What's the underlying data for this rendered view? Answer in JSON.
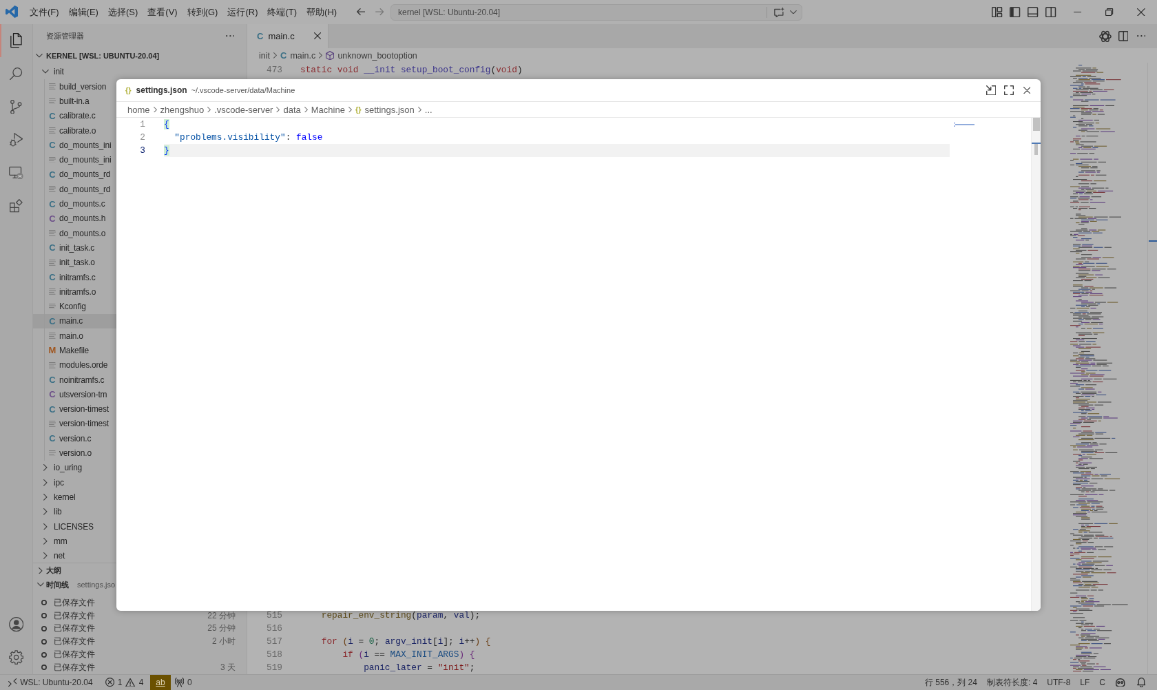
{
  "title_bar": {
    "menus": [
      "文件(F)",
      "编辑(E)",
      "选择(S)",
      "查看(V)",
      "转到(G)",
      "运行(R)",
      "终端(T)",
      "帮助(H)"
    ],
    "command_center": "kernel [WSL: Ubuntu-20.04]"
  },
  "activity_bar": {
    "top": [
      {
        "kind": "explorer",
        "selected": true
      },
      {
        "kind": "search",
        "selected": false
      },
      {
        "kind": "source-control",
        "selected": false
      },
      {
        "kind": "run-debug",
        "selected": false
      },
      {
        "kind": "remote",
        "selected": false
      },
      {
        "kind": "extensions",
        "selected": false
      }
    ],
    "bottom": [
      {
        "kind": "account"
      },
      {
        "kind": "settings"
      }
    ]
  },
  "sidebar": {
    "title": "资源管理器",
    "root": {
      "label": "KERNEL [WSL: UBUNTU-20.04]",
      "expanded": true
    },
    "tree": [
      {
        "label": "init",
        "kind": "folder",
        "expanded": true,
        "children": [
          {
            "label": "build_version",
            "kind": "text",
            "selected": false
          },
          {
            "label": "built-in.a",
            "kind": "text",
            "selected": false
          },
          {
            "label": "calibrate.c",
            "kind": "c",
            "glyph": "C",
            "selected": false
          },
          {
            "label": "calibrate.o",
            "kind": "text",
            "selected": false
          },
          {
            "label": "do_mounts_ini",
            "kind": "c",
            "glyph": "C",
            "selected": false
          },
          {
            "label": "do_mounts_ini",
            "kind": "text",
            "selected": false
          },
          {
            "label": "do_mounts_rd",
            "kind": "c",
            "glyph": "C",
            "selected": false
          },
          {
            "label": "do_mounts_rd",
            "kind": "text",
            "selected": false
          },
          {
            "label": "do_mounts.c",
            "kind": "c",
            "glyph": "C",
            "selected": false
          },
          {
            "label": "do_mounts.h",
            "kind": "h",
            "glyph": "C",
            "selected": false
          },
          {
            "label": "do_mounts.o",
            "kind": "text",
            "selected": false
          },
          {
            "label": "init_task.c",
            "kind": "c",
            "glyph": "C",
            "selected": false
          },
          {
            "label": "init_task.o",
            "kind": "text",
            "selected": false
          },
          {
            "label": "initramfs.c",
            "kind": "c",
            "glyph": "C",
            "selected": false
          },
          {
            "label": "initramfs.o",
            "kind": "text",
            "selected": false
          },
          {
            "label": "Kconfig",
            "kind": "text",
            "selected": false
          },
          {
            "label": "main.c",
            "kind": "c",
            "glyph": "C",
            "selected": true
          },
          {
            "label": "main.o",
            "kind": "text",
            "selected": false
          },
          {
            "label": "Makefile",
            "kind": "make",
            "glyph": "M",
            "selected": false
          },
          {
            "label": "modules.orde",
            "kind": "text",
            "selected": false
          },
          {
            "label": "noinitramfs.c",
            "kind": "c",
            "glyph": "C",
            "selected": false
          },
          {
            "label": "utsversion-tm",
            "kind": "h",
            "glyph": "C",
            "selected": false
          },
          {
            "label": "version-timest",
            "kind": "c",
            "glyph": "C",
            "selected": false
          },
          {
            "label": "version-timest",
            "kind": "text",
            "selected": false
          },
          {
            "label": "version.c",
            "kind": "c",
            "glyph": "C",
            "selected": false
          },
          {
            "label": "version.o",
            "kind": "text",
            "selected": false
          }
        ]
      },
      {
        "label": "io_uring",
        "kind": "folder",
        "expanded": false
      },
      {
        "label": "ipc",
        "kind": "folder",
        "expanded": false
      },
      {
        "label": "kernel",
        "kind": "folder",
        "expanded": false
      },
      {
        "label": "lib",
        "kind": "folder",
        "expanded": false
      },
      {
        "label": "LICENSES",
        "kind": "folder",
        "expanded": false
      },
      {
        "label": "mm",
        "kind": "folder",
        "expanded": false
      },
      {
        "label": "net",
        "kind": "folder",
        "expanded": false
      }
    ],
    "outline": {
      "title": "大纲",
      "expanded": false
    },
    "timeline": {
      "title": "时间线",
      "expanded": true,
      "file": "settings.jso",
      "items": [
        {
          "label": "已保存文件"
        },
        {
          "label": "已保存文件",
          "time": "22 分钟"
        },
        {
          "label": "已保存文件",
          "time": "25 分钟"
        },
        {
          "label": "已保存文件",
          "time": "2 小时"
        },
        {
          "label": "已保存文件"
        },
        {
          "label": "已保存文件",
          "time": "3 天"
        }
      ]
    }
  },
  "editor": {
    "tabs": [
      {
        "label": "main.c",
        "glyph": "C",
        "selected": true
      }
    ],
    "breadcrumbs": [
      {
        "kind": "folder",
        "label": "init"
      },
      {
        "kind": "file",
        "glyph": "C",
        "label": "main.c"
      },
      {
        "kind": "symbol",
        "label": "unknown_bootoption"
      }
    ],
    "code_top": [
      {
        "number": "473",
        "tokens": [
          {
            "text": "static void",
            "kind": "keyword"
          },
          {
            "text": " __init setup_boot_config",
            "kind": "macro"
          },
          {
            "text": "(",
            "kind": "plain"
          },
          {
            "text": "void",
            "kind": "keyword"
          },
          {
            "text": ")",
            "kind": "plain"
          }
        ]
      }
    ],
    "code_bottom": [
      {
        "number": "515",
        "tokens": [
          {
            "text": "    repair_env_string",
            "kind": "function"
          },
          {
            "text": "(",
            "kind": "plain"
          },
          {
            "text": "param",
            "kind": "variable"
          },
          {
            "text": ", ",
            "kind": "plain"
          },
          {
            "text": "val",
            "kind": "variable"
          },
          {
            "text": ");",
            "kind": "plain"
          }
        ]
      },
      {
        "number": "516"
      },
      {
        "number": "517",
        "tokens": [
          {
            "text": "    for",
            "kind": "keyword"
          },
          {
            "text": " (",
            "kind": "bracket"
          },
          {
            "text": "i",
            "kind": "variable"
          },
          {
            "text": " = ",
            "kind": "plain"
          },
          {
            "text": "0",
            "kind": "number"
          },
          {
            "text": "; ",
            "kind": "plain"
          },
          {
            "text": "argv_init",
            "kind": "variable"
          },
          {
            "text": "[",
            "kind": "plain"
          },
          {
            "text": "i",
            "kind": "variable"
          },
          {
            "text": "]; ",
            "kind": "plain"
          },
          {
            "text": "i",
            "kind": "variable"
          },
          {
            "text": "++",
            "kind": "plain"
          },
          {
            "text": ") {",
            "kind": "bracket"
          }
        ]
      },
      {
        "number": "518",
        "tokens": [
          {
            "text": "        if",
            "kind": "keyword"
          },
          {
            "text": " (",
            "kind": "bracket2"
          },
          {
            "text": "i",
            "kind": "variable"
          },
          {
            "text": " == ",
            "kind": "plain"
          },
          {
            "text": "MAX_INIT_ARGS",
            "kind": "constant"
          },
          {
            "text": ") {",
            "kind": "bracket2"
          }
        ]
      },
      {
        "number": "519",
        "tokens": [
          {
            "text": "            panic_later",
            "kind": "variable"
          },
          {
            "text": " = ",
            "kind": "plain"
          },
          {
            "text": "\"init\"",
            "kind": "string"
          },
          {
            "text": ";",
            "kind": "plain"
          }
        ]
      }
    ]
  },
  "peek": {
    "glyph": "{}",
    "title": "settings.json",
    "path": "~/.vscode-server/data/Machine",
    "breadcrumbs": [
      {
        "kind": "folder",
        "label": "home"
      },
      {
        "kind": "folder",
        "label": "zhengshuo"
      },
      {
        "kind": "folder",
        "label": ".vscode-server"
      },
      {
        "kind": "folder",
        "label": "data"
      },
      {
        "kind": "folder",
        "label": "Machine"
      },
      {
        "kind": "file",
        "glyph": "{}",
        "label": "settings.json"
      },
      {
        "kind": "more",
        "label": "..."
      }
    ],
    "lines": [
      {
        "number": "1",
        "active": false,
        "tokens": [
          {
            "text": "{",
            "kind": "bracket-match"
          }
        ]
      },
      {
        "number": "2",
        "active": false,
        "tokens": [
          {
            "text": "  \"problems.visibility\"",
            "kind": "key"
          },
          {
            "text": ": ",
            "kind": "plain"
          },
          {
            "text": "false",
            "kind": "literal"
          }
        ]
      },
      {
        "number": "3",
        "active": true,
        "tokens": [
          {
            "text": "}",
            "kind": "bracket-match"
          }
        ]
      }
    ]
  },
  "status_bar": {
    "left": [
      {
        "kind": "remote",
        "label": "WSL: Ubuntu-20.04"
      },
      {
        "kind": "problems",
        "errors": "1",
        "warnings": "4"
      },
      {
        "kind": "highlight",
        "label": "ab"
      },
      {
        "kind": "ports",
        "label": "0"
      }
    ],
    "right": [
      "行 556，列 24",
      "制表符长度: 4",
      "UTF-8",
      "LF",
      "C"
    ]
  }
}
